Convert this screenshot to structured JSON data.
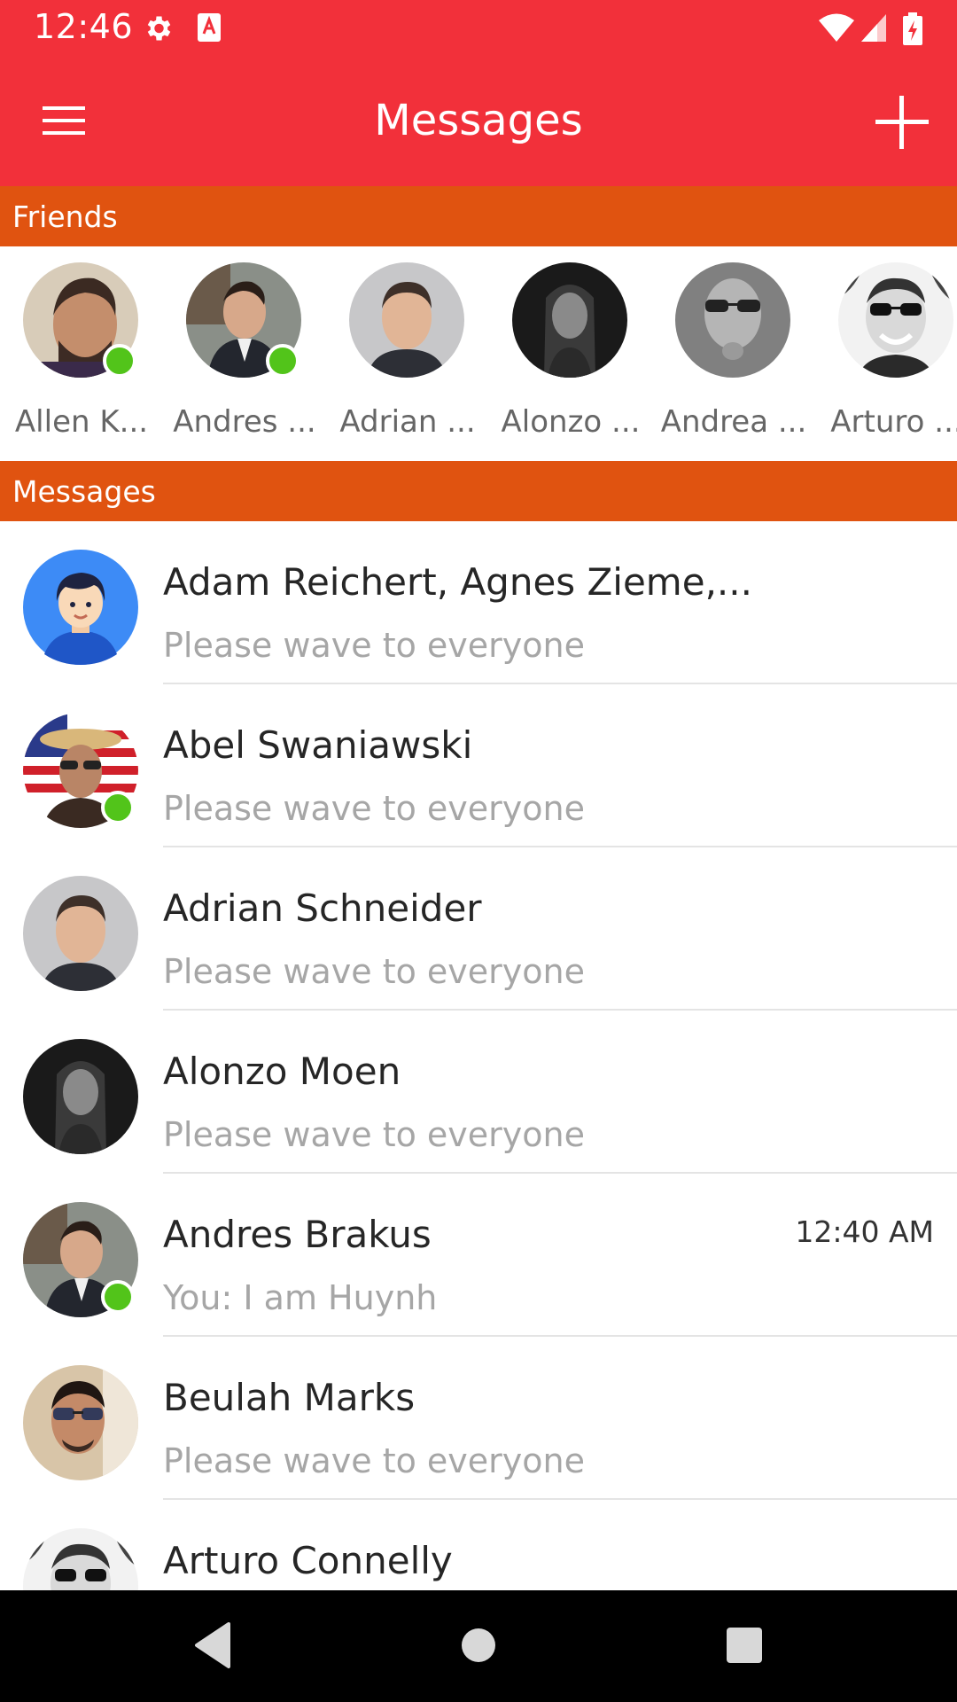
{
  "status_bar": {
    "time": "12:46",
    "icons": [
      "gear-icon",
      "a-badge-icon",
      "wifi-icon",
      "signal-icon",
      "battery-charging-icon"
    ]
  },
  "app_bar": {
    "title": "Messages",
    "left_icon": "menu-icon",
    "right_icon": "add-icon"
  },
  "colors": {
    "primary": "#f2303a",
    "section": "#e05310",
    "online": "#52c41a",
    "secondary_text": "#a6a6a6"
  },
  "friends_header": "Friends",
  "friends": [
    {
      "name": "Allen K...",
      "online": true
    },
    {
      "name": "Andres ...",
      "online": true
    },
    {
      "name": "Adrian ...",
      "online": false
    },
    {
      "name": "Alonzo ...",
      "online": false
    },
    {
      "name": "Andrea ...",
      "online": false
    },
    {
      "name": "Arturo ...",
      "online": false
    }
  ],
  "messages_header": "Messages",
  "messages": [
    {
      "title": "Adam Reichert, Agnes Zieme,...",
      "preview": "Please wave to everyone",
      "time": "",
      "online": false
    },
    {
      "title": "Abel Swaniawski",
      "preview": "Please wave to everyone",
      "time": "",
      "online": true
    },
    {
      "title": "Adrian Schneider",
      "preview": "Please wave to everyone",
      "time": "",
      "online": false
    },
    {
      "title": "Alonzo Moen",
      "preview": "Please wave to everyone",
      "time": "",
      "online": false
    },
    {
      "title": "Andres Brakus",
      "preview": "You: I am Huynh",
      "time": "12:40 AM",
      "online": true
    },
    {
      "title": "Beulah Marks",
      "preview": "Please wave to everyone",
      "time": "",
      "online": false
    },
    {
      "title": "Arturo Connelly",
      "preview": "",
      "time": "",
      "online": false
    }
  ],
  "nav_bar": {
    "buttons": [
      "back-icon",
      "home-icon",
      "recents-icon"
    ]
  }
}
